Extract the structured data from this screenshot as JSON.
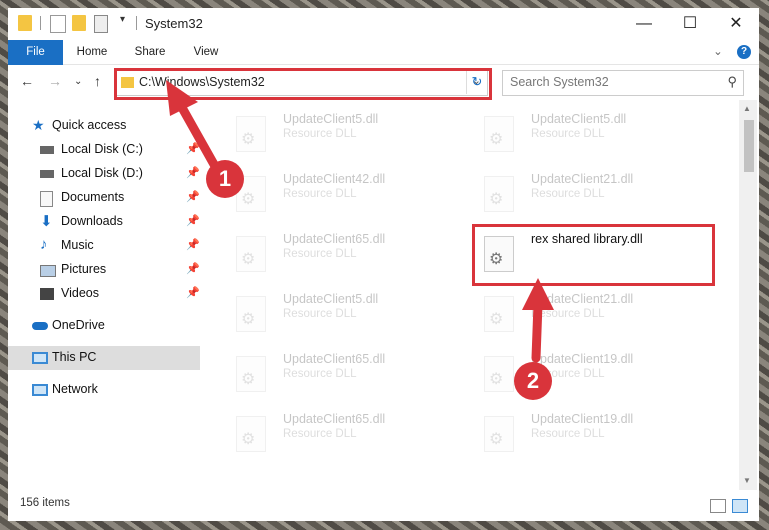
{
  "window": {
    "title": "System32",
    "minimize": "—",
    "maximize": "☐",
    "close": "✕"
  },
  "ribbon": {
    "tabs": [
      "File",
      "Home",
      "Share",
      "View"
    ],
    "expand": "⌄",
    "help": "?"
  },
  "address": {
    "path": "C:\\Windows\\System32",
    "search_placeholder": "Search System32"
  },
  "nav_icons": {
    "back": "←",
    "forward": "→",
    "recent": "⌄",
    "up": "↑",
    "refresh": "↻",
    "search": "⚲"
  },
  "sidebar": {
    "items": [
      {
        "label": "Quick access",
        "icon": "star-icon",
        "pinned": false
      },
      {
        "label": "Local Disk (C:)",
        "icon": "drive-icon",
        "pinned": true
      },
      {
        "label": "Local Disk (D:)",
        "icon": "drive-icon",
        "pinned": true
      },
      {
        "label": "Documents",
        "icon": "documents-icon",
        "pinned": true
      },
      {
        "label": "Downloads",
        "icon": "download-icon",
        "pinned": true
      },
      {
        "label": "Music",
        "icon": "music-icon",
        "pinned": true
      },
      {
        "label": "Pictures",
        "icon": "pictures-icon",
        "pinned": true
      },
      {
        "label": "Videos",
        "icon": "videos-icon",
        "pinned": true
      },
      {
        "label": "OneDrive",
        "icon": "cloud-icon",
        "pinned": false
      },
      {
        "label": "This PC",
        "icon": "pc-icon",
        "pinned": false,
        "selected": true
      },
      {
        "label": "Network",
        "icon": "network-icon",
        "pinned": false
      }
    ],
    "pin_glyph": "📌"
  },
  "files": {
    "left": [
      {
        "name": "UpdateClient5.dll",
        "type": "Resource DLL"
      },
      {
        "name": "UpdateClient42.dll",
        "type": "Resource DLL"
      },
      {
        "name": "UpdateClient65.dll",
        "type": "Resource DLL"
      },
      {
        "name": "UpdateClient5.dll",
        "type": "Resource DLL"
      },
      {
        "name": "UpdateClient65.dll",
        "type": "Resource DLL"
      },
      {
        "name": "UpdateClient65.dll",
        "type": "Resource DLL"
      }
    ],
    "right": [
      {
        "name": "UpdateClient5.dll",
        "type": "Resource DLL"
      },
      {
        "name": "UpdateClient21.dll",
        "type": "Resource DLL"
      },
      {
        "name": "rex shared library.dll",
        "type": "",
        "highlighted": true
      },
      {
        "name": "UpdateClient21.dll",
        "type": "Resource DLL"
      },
      {
        "name": "UpdateClient19.dll",
        "type": "Resource DLL"
      },
      {
        "name": "UpdateClient19.dll",
        "type": "Resource DLL"
      }
    ],
    "gear_glyph": "⚙"
  },
  "status": {
    "count": "156 items"
  },
  "annotations": {
    "badge1": "1",
    "badge2": "2",
    "accent": "#d9343b"
  }
}
